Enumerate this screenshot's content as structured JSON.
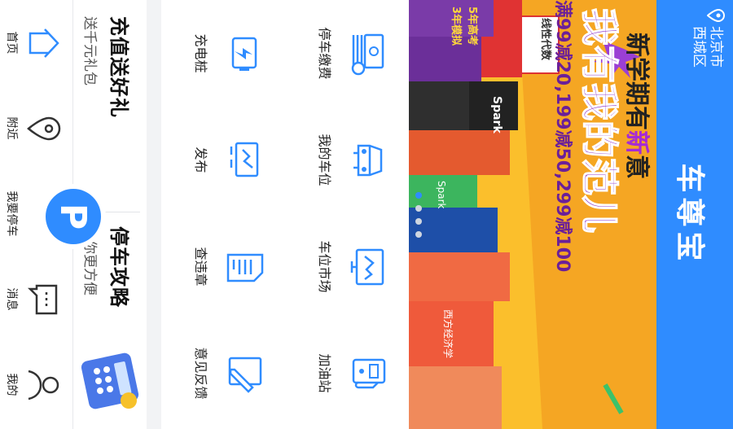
{
  "header": {
    "city": "北京市",
    "district": "西城区",
    "title": "车尊宝",
    "location_icon": "location-pin-icon"
  },
  "banner": {
    "headline_1": "新学期有",
    "headline_highlight": "新",
    "headline_2": "意",
    "headline_main": "我有我的范儿",
    "offer": "满99减20,199减50,299减100",
    "book_texts": [
      "线性代数",
      "5年高考",
      "3年模拟",
      "Spark",
      "Spark",
      "西方经济学"
    ],
    "slide_count": 4,
    "active_slide": 1
  },
  "services": [
    {
      "label": "停车缴费",
      "icon": "money-stack-icon"
    },
    {
      "label": "我的车位",
      "icon": "car-icon"
    },
    {
      "label": "车位市场",
      "icon": "parking-market-icon"
    },
    {
      "label": "加油站",
      "icon": "fuel-pump-icon"
    },
    {
      "label": "充电桩",
      "icon": "battery-charge-icon"
    },
    {
      "label": "发布",
      "icon": "publish-truck-icon"
    },
    {
      "label": "查违章",
      "icon": "document-list-icon"
    },
    {
      "label": "意见反馈",
      "icon": "pencil-feedback-icon"
    }
  ],
  "promo": {
    "left_title": "充值送好礼",
    "left_sub": "送千元礼包",
    "right_title": "停车攻略",
    "right_sub": "有你更方便",
    "right_image": "calculator-icon"
  },
  "tabs": [
    {
      "label": "首页",
      "icon": "home-icon"
    },
    {
      "label": "附近",
      "icon": "map-pin-icon"
    },
    {
      "label": "我要停车",
      "icon": "parking-p-icon"
    },
    {
      "label": "消息",
      "icon": "message-icon"
    },
    {
      "label": "我的",
      "icon": "user-icon"
    }
  ],
  "fab": {
    "label": "P"
  },
  "colors": {
    "primary": "#2f8cff",
    "banner_bg": "#f5a623",
    "banner_purple": "#7a3ba8"
  }
}
